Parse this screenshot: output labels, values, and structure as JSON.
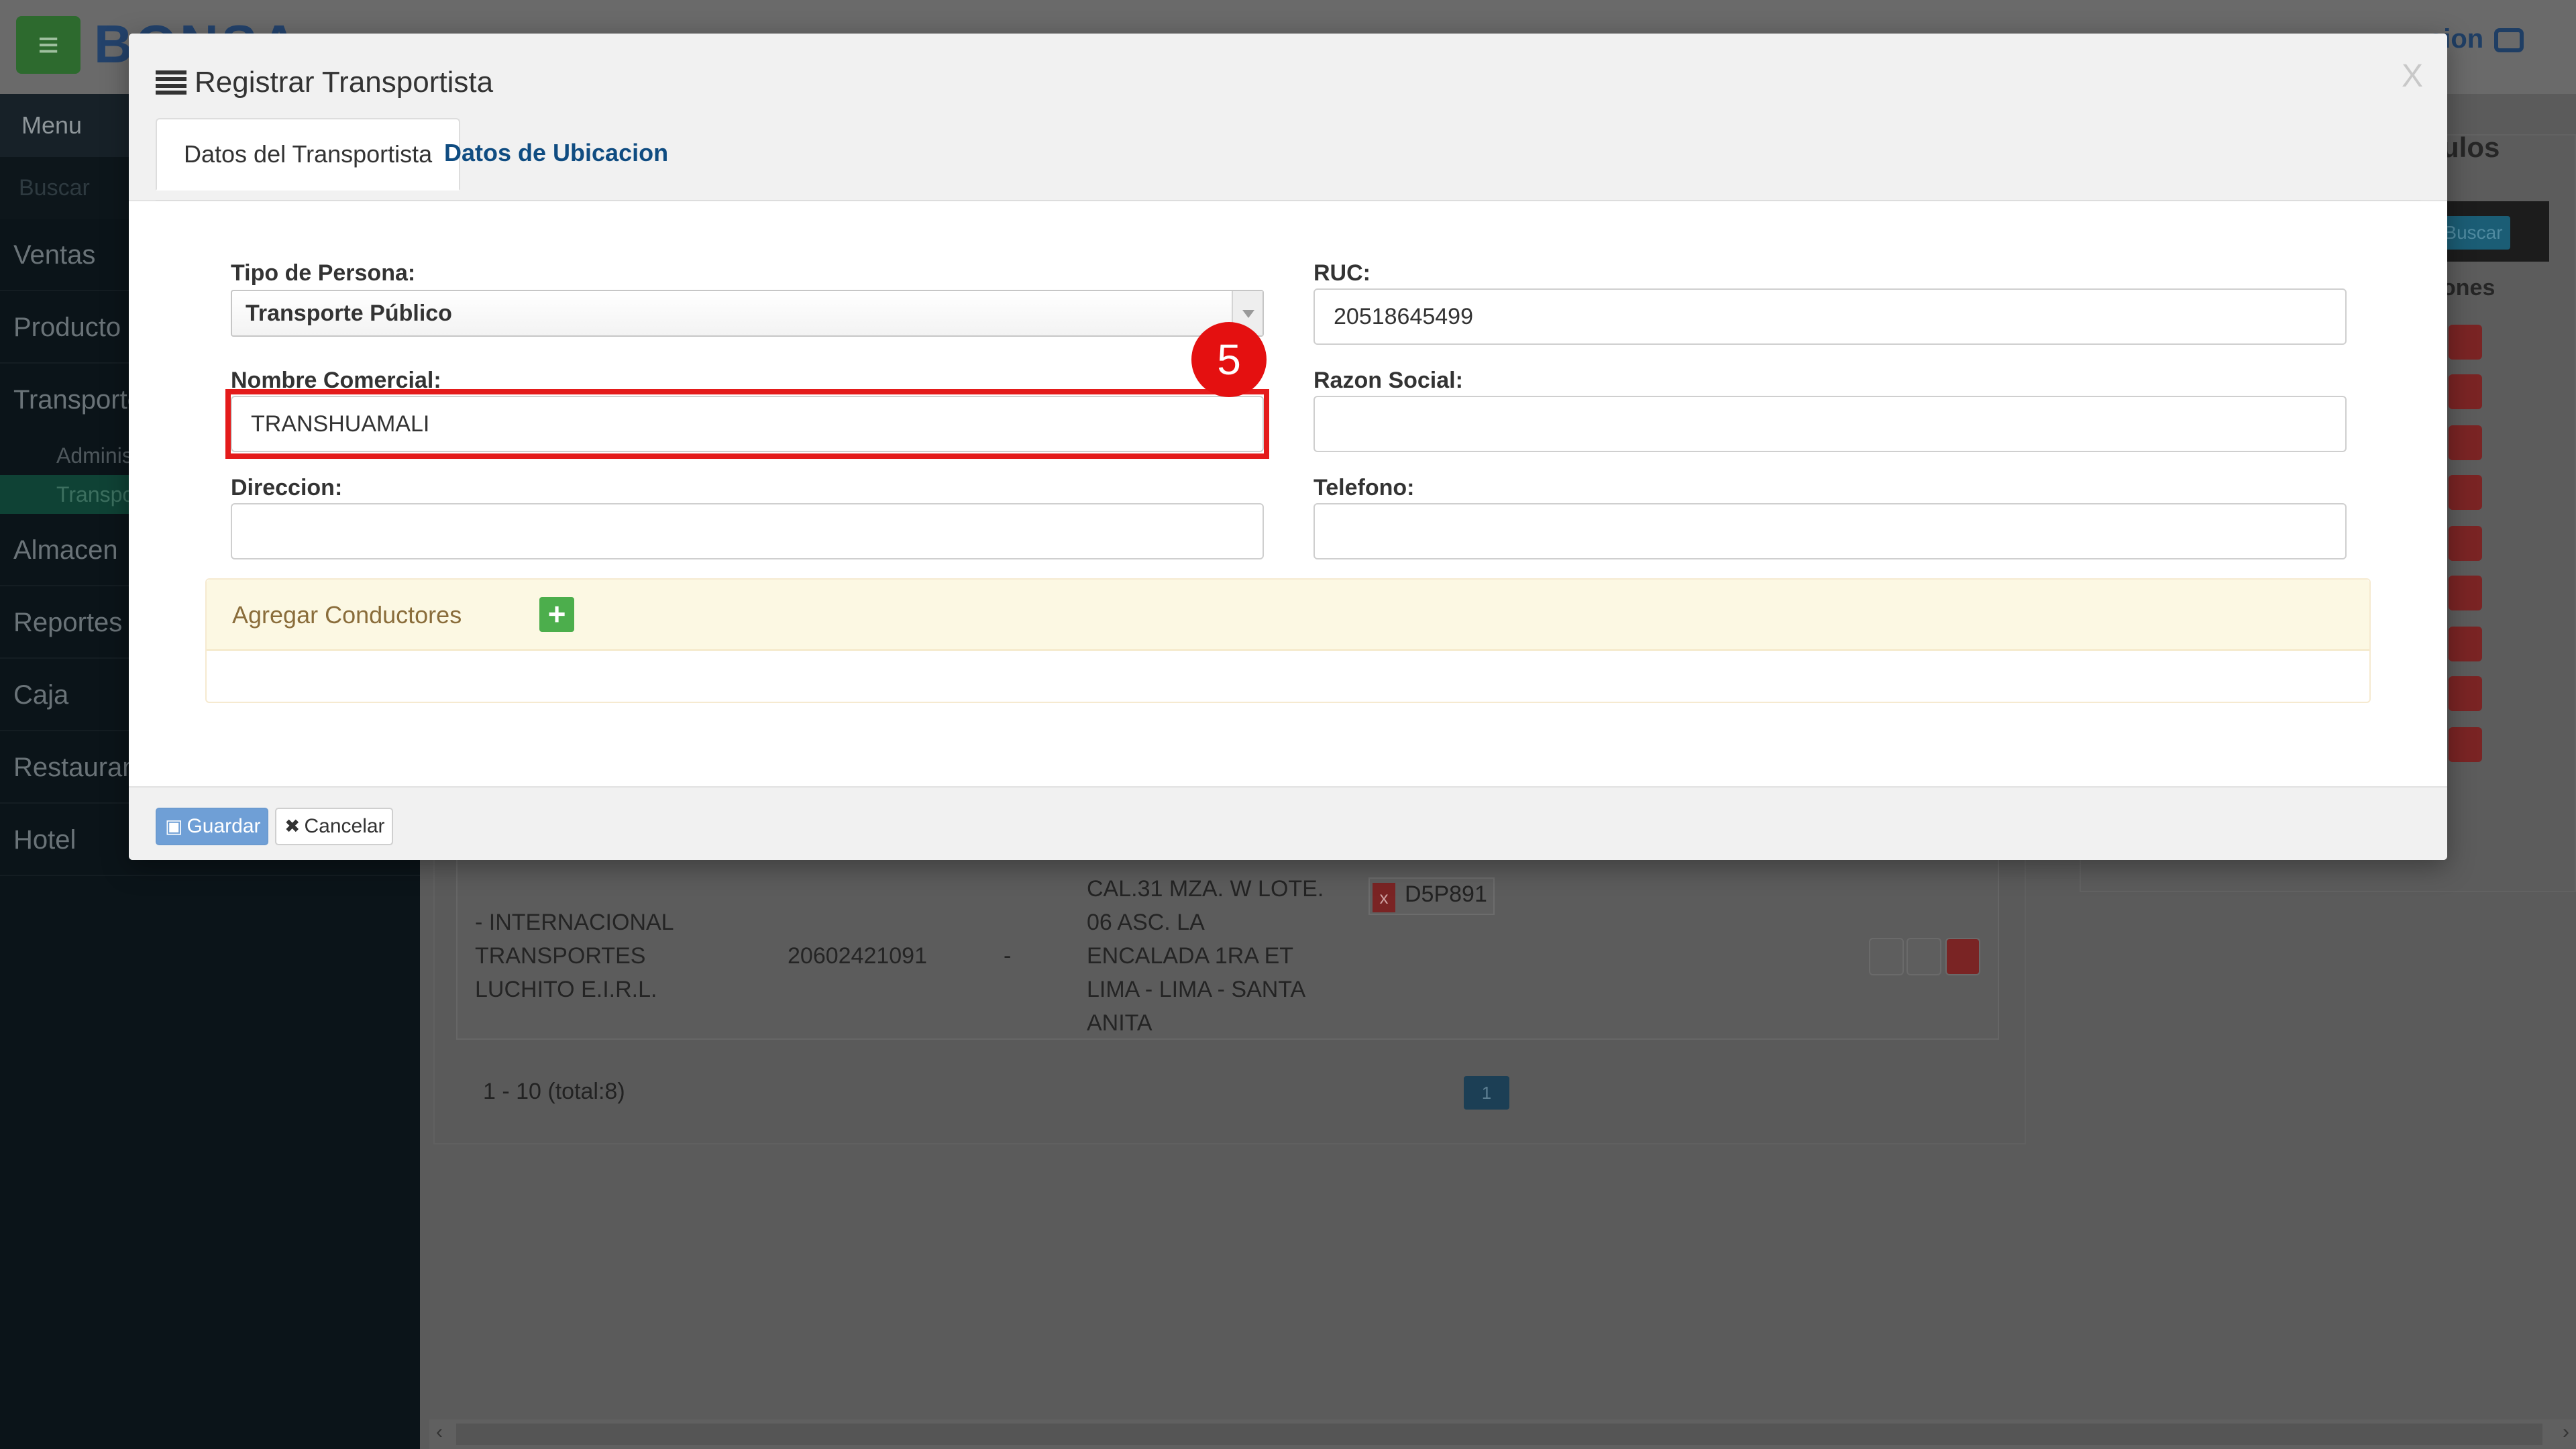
{
  "background": {
    "logout_label": "sion",
    "brand_text": "BONSA",
    "menu_icon": "hamburger-icon",
    "sidebar": {
      "menu_label": "Menu",
      "search_placeholder": "Buscar",
      "items": [
        "Ventas",
        "Producto",
        "Transporte",
        "Almacen",
        "Reportes",
        "Caja",
        "Restaurant",
        "Hotel"
      ],
      "sub_items": [
        "Administrar",
        "Transportistas"
      ]
    },
    "table_row": {
      "name": "- INTERNACIONAL TRANSPORTES LUCHITO E.I.R.L.",
      "ruc": "20602421091",
      "phone": "-",
      "address": "CAL.31 MZA. W LOTE. 06 ASC. LA ENCALADA 1RA ET LIMA - LIMA - SANTA ANITA",
      "plate": "D5P891",
      "plate_remove": "x"
    },
    "pager": {
      "info": "1 - 10 (total:8)",
      "page": "1"
    },
    "right_panel": {
      "title": "ulos",
      "buscar": "Buscar",
      "column": "ones"
    }
  },
  "modal": {
    "title": "Registrar Transportista",
    "close": "X",
    "tabs": [
      "Datos del Transportista",
      "Datos de Ubicacion"
    ],
    "fields": {
      "tipo_persona": {
        "label": "Tipo de Persona:",
        "value": "Transporte Público"
      },
      "ruc": {
        "label": "RUC:",
        "value": "20518645499"
      },
      "nombre_comercial": {
        "label": "Nombre Comercial:",
        "value": "TRANSHUAMALI"
      },
      "razon_social": {
        "label": "Razon Social:",
        "value": ""
      },
      "direccion": {
        "label": "Direccion:",
        "value": ""
      },
      "telefono": {
        "label": "Telefono:",
        "value": ""
      }
    },
    "conductores": {
      "label": "Agregar Conductores",
      "add_icon": "+"
    },
    "footer": {
      "save_label": "Guardar",
      "cancel_label": "Cancelar",
      "cancel_icon": "✖"
    }
  },
  "annotation": {
    "step": "5",
    "color": "#e41b1b"
  }
}
